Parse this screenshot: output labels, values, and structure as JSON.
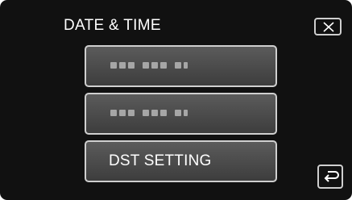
{
  "header": {
    "title": "DATE & TIME"
  },
  "menu": {
    "items": [
      {
        "label": "",
        "state": "placeholder"
      },
      {
        "label": "",
        "state": "placeholder"
      },
      {
        "label": "DST SETTING",
        "state": "normal"
      }
    ]
  },
  "icons": {
    "close": "close-icon",
    "back": "return-arrow-icon"
  },
  "colors": {
    "background": "#111111",
    "button_fill": "#4a4a4a",
    "button_border": "#cfcfcf",
    "text": "#ffffff"
  }
}
